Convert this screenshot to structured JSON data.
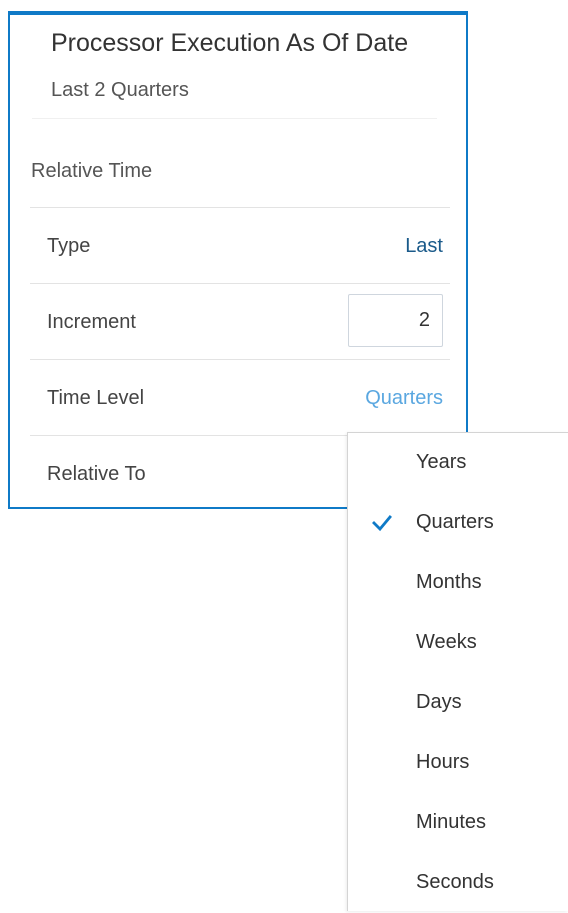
{
  "panel": {
    "title": "Processor Execution As Of Date",
    "subtitle": "Last 2 Quarters",
    "section_label": "Relative Time",
    "rows": {
      "type": {
        "label": "Type",
        "value": "Last"
      },
      "increment": {
        "label": "Increment",
        "value": "2"
      },
      "time_level": {
        "label": "Time Level",
        "value": "Quarters"
      },
      "relative_to": {
        "label": "Relative To"
      }
    }
  },
  "dropdown": {
    "selected": "Quarters",
    "items": [
      {
        "label": "Years"
      },
      {
        "label": "Quarters"
      },
      {
        "label": "Months"
      },
      {
        "label": "Weeks"
      },
      {
        "label": "Days"
      },
      {
        "label": "Hours"
      },
      {
        "label": "Minutes"
      },
      {
        "label": "Seconds"
      }
    ]
  },
  "icons": {
    "selected_check": "check-icon"
  },
  "colors": {
    "accent": "#0f7ac7",
    "value_dark": "#1a5a8a",
    "value_light": "#5aa7e0"
  }
}
